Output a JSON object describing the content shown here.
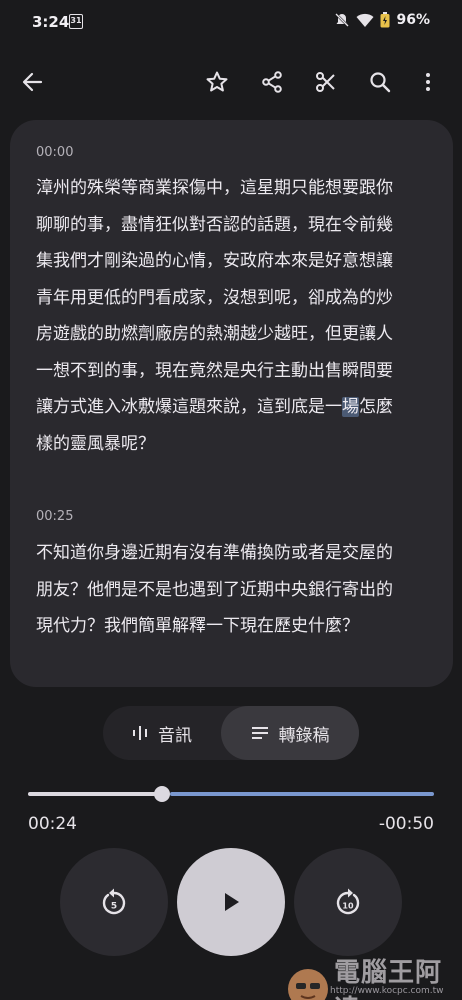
{
  "status_bar": {
    "time": "3:24",
    "calendar_day": "31",
    "battery": "96%"
  },
  "toolbar": {
    "icons": [
      "back-arrow-icon",
      "star-icon",
      "share-icon",
      "scissors-icon",
      "search-icon",
      "more-vert-icon"
    ]
  },
  "transcript": {
    "segments": [
      {
        "time": "00:00",
        "lines": [
          "漳州的殊榮等商業探傷中，這星期只能想要跟你",
          "聊聊的事，盡情狂似對否認的話題，現在令前幾",
          "集我們才剛染過的心情，安政府本來是好意想讓",
          "青年用更低的門看成家，沒想到呢，卻成為的炒",
          "房遊戲的助燃劑廠房的熱潮越少越旺，但更讓人",
          "一想不到的事，現在竟然是央行主動出售瞬間要",
          "讓方式進入冰敷爆這題來說，這到底是一",
          "樣的靈風暴呢？"
        ],
        "line7_highlight": "場",
        "line7_tail": "怎麼"
      },
      {
        "time": "00:25",
        "lines": [
          "不知道你身邊近期有沒有準備換防或者是交屋的",
          "朋友？他們是不是也遇到了近期中央銀行寄出的",
          "現代力？我們簡單解釋一下現在歷史什麼？"
        ]
      }
    ]
  },
  "view_toggle": {
    "audio_label": "音訊",
    "transcript_label": "轉錄稿",
    "selected": "transcript"
  },
  "player": {
    "elapsed": "00:24",
    "remaining": "-00:50",
    "progress_fraction": 0.33,
    "rewind_seconds": "5",
    "forward_seconds": "10"
  },
  "watermark": {
    "text": "電腦王阿達",
    "url": "http://www.kocpc.com.tw"
  }
}
